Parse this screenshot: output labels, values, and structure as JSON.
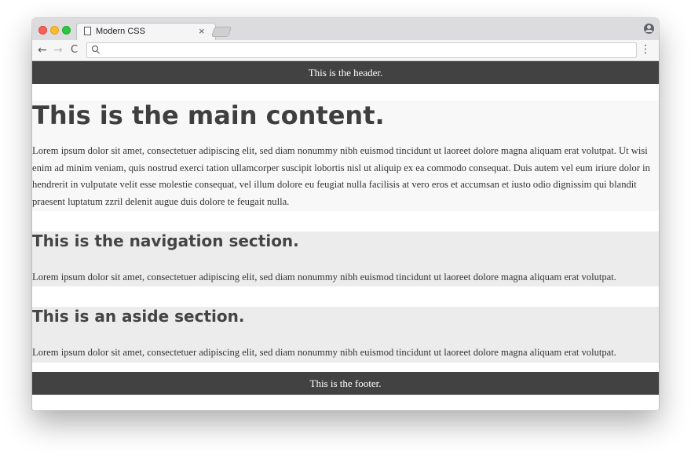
{
  "browser": {
    "tab_title": "Modern CSS",
    "tab_close": "×",
    "nav": {
      "back": "←",
      "forward": "→",
      "reload": "C"
    },
    "menu": "⋮"
  },
  "page": {
    "header": "This is the header.",
    "main": {
      "heading": "This is the main content.",
      "text": "Lorem ipsum dolor sit amet, consectetuer adipiscing elit, sed diam nonummy nibh euismod tincidunt ut laoreet dolore magna aliquam erat volutpat. Ut wisi enim ad minim veniam, quis nostrud exerci tation ullamcorper suscipit lobortis nisl ut aliquip ex ea commodo consequat. Duis autem vel eum iriure dolor in hendrerit in vulputate velit esse molestie consequat, vel illum dolore eu feugiat nulla facilisis at vero eros et accumsan et iusto odio dignissim qui blandit praesent luptatum zzril delenit augue duis dolore te feugait nulla."
    },
    "nav": {
      "heading": "This is the navigation section.",
      "text": "Lorem ipsum dolor sit amet, consectetuer adipiscing elit, sed diam nonummy nibh euismod tincidunt ut laoreet dolore magna aliquam erat volutpat."
    },
    "aside": {
      "heading": "This is an aside section.",
      "text": "Lorem ipsum dolor sit amet, consectetuer adipiscing elit, sed diam nonummy nibh euismod tincidunt ut laoreet dolore magna aliquam erat volutpat."
    },
    "footer": "This is the footer."
  },
  "colors": {
    "header_bg": "#424242",
    "footer_bg": "#424242",
    "main_bg": "#f8f8f8",
    "section_bg": "#ececec"
  },
  "icons": {
    "tab": "document-icon",
    "search": "search-icon",
    "profile": "profile-icon"
  }
}
